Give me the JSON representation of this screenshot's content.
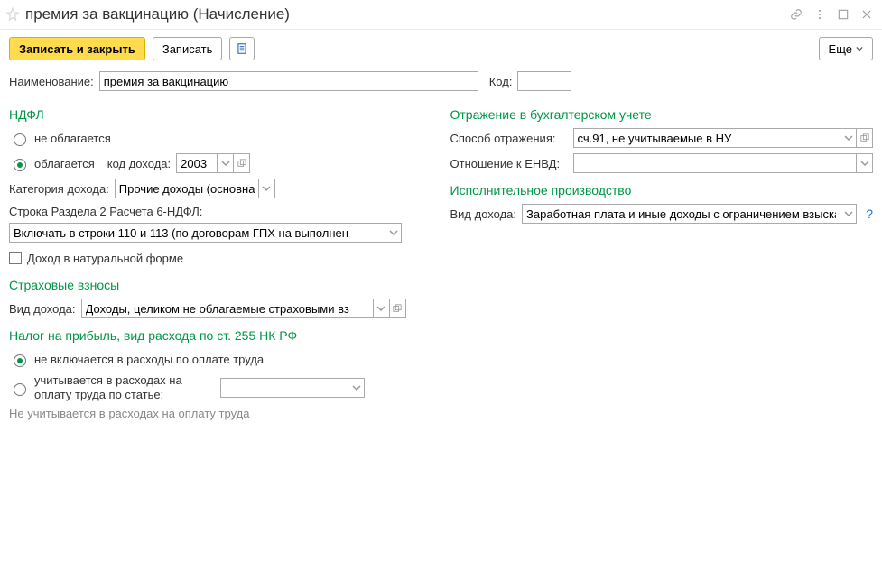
{
  "title": "премия за вакцинацию (Начисление)",
  "toolbar": {
    "save_close": "Записать и закрыть",
    "save": "Записать",
    "more": "Еще"
  },
  "fields": {
    "name_label": "Наименование:",
    "name_value": "премия за вакцинацию",
    "code_label": "Код:",
    "code_value": ""
  },
  "ndfl": {
    "heading": "НДФЛ",
    "not_taxed": "не облагается",
    "taxed": "облагается",
    "income_code_label": "код дохода:",
    "income_code_value": "2003",
    "category_label": "Категория дохода:",
    "category_value": "Прочие доходы (основна",
    "line6_label": "Строка Раздела 2 Расчета 6-НДФЛ:",
    "line6_value": "Включать в строки 110 и 113 (по договорам ГПХ на выполнен",
    "natural_income": "Доход в натуральной форме"
  },
  "insurance": {
    "heading": "Страховые взносы",
    "kind_label": "Вид дохода:",
    "kind_value": "Доходы, целиком не облагаемые страховыми вз"
  },
  "profit_tax": {
    "heading": "Налог на прибыль, вид расхода по ст. 255 НК РФ",
    "not_included": "не включается в расходы по оплате труда",
    "included": "учитывается в расходах на оплату труда по статье:",
    "note": "Не учитывается в расходах на оплату труда"
  },
  "accounting": {
    "heading": "Отражение в бухгалтерском учете",
    "method_label": "Способ отражения:",
    "method_value": "сч.91, не учитываемые в НУ",
    "envd_label": "Отношение к ЕНВД:",
    "envd_value": ""
  },
  "exec": {
    "heading": "Исполнительное производство",
    "kind_label": "Вид дохода:",
    "kind_value": "Заработная плата и иные доходы с ограничением взыска"
  }
}
